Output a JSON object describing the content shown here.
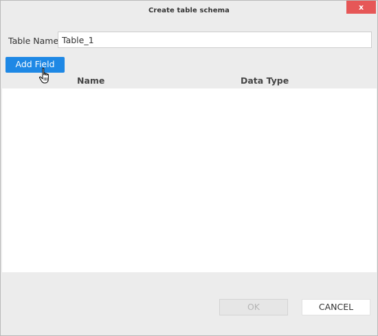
{
  "dialog": {
    "title": "Create table schema",
    "close_label": "x"
  },
  "form": {
    "table_name_label": "Table Name",
    "table_name_value": "Table_1"
  },
  "toolbar": {
    "add_field_label": "Add Field"
  },
  "grid": {
    "columns": [
      "Name",
      "Data Type"
    ],
    "rows": []
  },
  "footer": {
    "ok_label": "OK",
    "cancel_label": "CANCEL",
    "ok_enabled": false
  },
  "colors": {
    "accent": "#1e88e5",
    "close": "#e65757",
    "dialog_bg": "#ececec"
  },
  "icons": {
    "cursor": "hand-pointer-icon"
  }
}
